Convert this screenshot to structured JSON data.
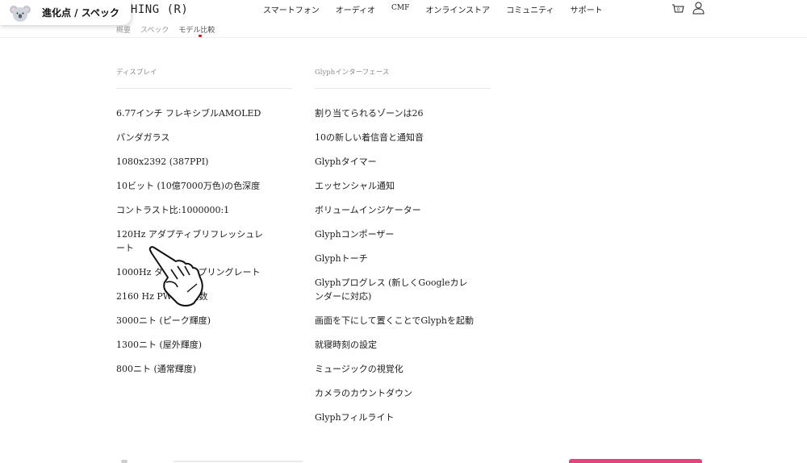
{
  "header": {
    "logo": "THING (R)",
    "nav": [
      "スマートフォン",
      "オーディオ",
      "CMF",
      "オンラインストア",
      "コミュニティ",
      "サポート"
    ],
    "cart_count": "0"
  },
  "badge": {
    "label": "進化点 / スペック"
  },
  "subnav": {
    "items": [
      "概要",
      "スペック",
      "モデル比較"
    ]
  },
  "display": {
    "heading": "ディスプレイ",
    "items": [
      "6.77インチ フレキシブルAMOLED",
      "パンダガラス",
      "1080x2392 (387PPI)",
      "10ビット (10億7000万色)の色深度",
      "コントラスト比:1000000:1",
      "120Hz アダプティブリフレッシュレート",
      "1000Hz タッチサンプリングレート",
      "2160 Hz PWM周波数",
      "3000ニト (ピーク輝度)",
      "1300ニト (屋外輝度)",
      "800ニト (通常輝度)"
    ]
  },
  "glyph": {
    "heading": "Glyphインターフェース",
    "items": [
      "割り当てられるゾーンは26",
      "10の新しい着信音と通知音",
      "Glyphタイマー",
      "エッセンシャル通知",
      "ボリュームインジケーター",
      "Glyphコンポーザー",
      "Glyphトーチ",
      "Glyphプログレス (新しくGoogleカレンダーに対応)",
      "画面を下にして置くことでGlyphを起動",
      "就寝時刻の設定",
      "ミュージックの視覚化",
      "カメラのカウントダウン",
      "Glyphフィルライト"
    ]
  },
  "colors": {
    "accent": "#d71921",
    "bottom_button": "#e0457b"
  }
}
